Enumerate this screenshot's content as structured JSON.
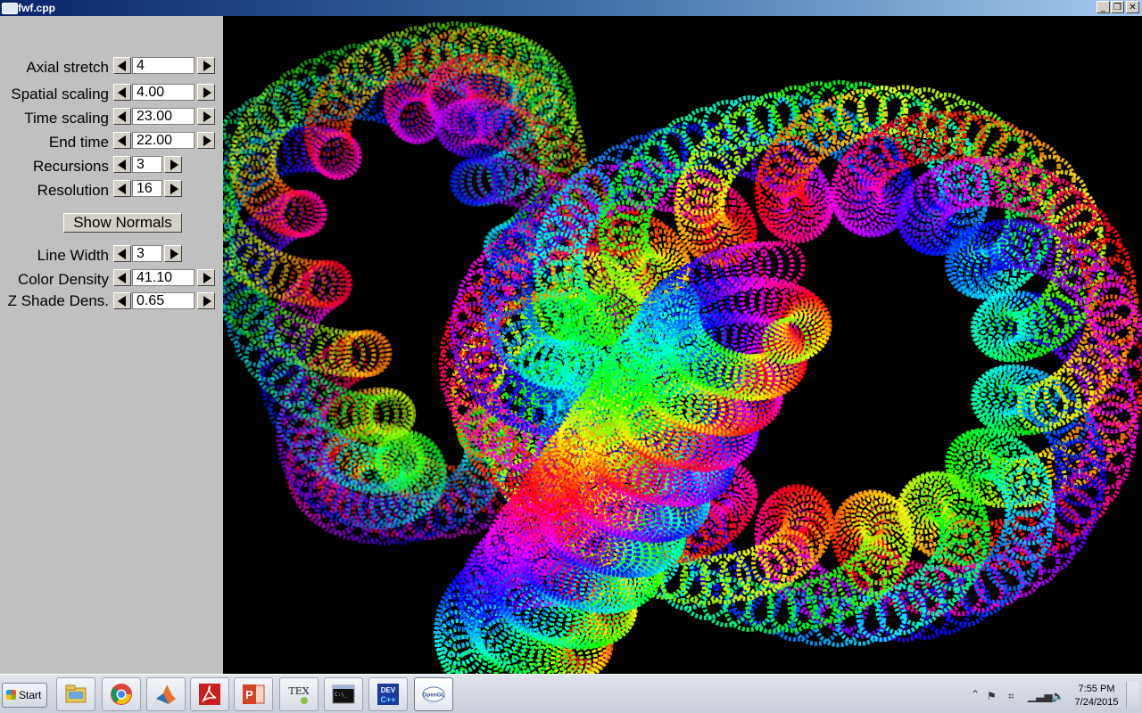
{
  "window": {
    "title": "fwf.cpp"
  },
  "controls": [
    {
      "label": "Axial stretch",
      "value": "4"
    },
    {
      "label": "Spatial scaling",
      "value": "4.00"
    },
    {
      "label": "Time scaling",
      "value": "23.00"
    },
    {
      "label": "End time",
      "value": "22.00"
    },
    {
      "label": "Recursions",
      "value": "3"
    },
    {
      "label": "Resolution",
      "value": "16"
    },
    {
      "label": "Line Width",
      "value": "3"
    },
    {
      "label": "Color Density",
      "value": "41.10"
    },
    {
      "label": "Z Shade Dens.",
      "value": "0.65"
    }
  ],
  "show_normals_label": "Show Normals",
  "taskbar": {
    "start_label": "Start",
    "apps": [
      "file-explorer-icon",
      "chrome-icon",
      "matlab-icon",
      "acrobat-icon",
      "powerpoint-icon",
      "tex-icon",
      "cmd-icon",
      "devcpp-icon",
      "opengl-icon"
    ],
    "clock_time": "7:55 PM",
    "clock_date": "7/24/2015"
  },
  "colors": {
    "titlebar": "#0a246a",
    "panel": "#c0c0c0",
    "canvas": "#000000"
  }
}
